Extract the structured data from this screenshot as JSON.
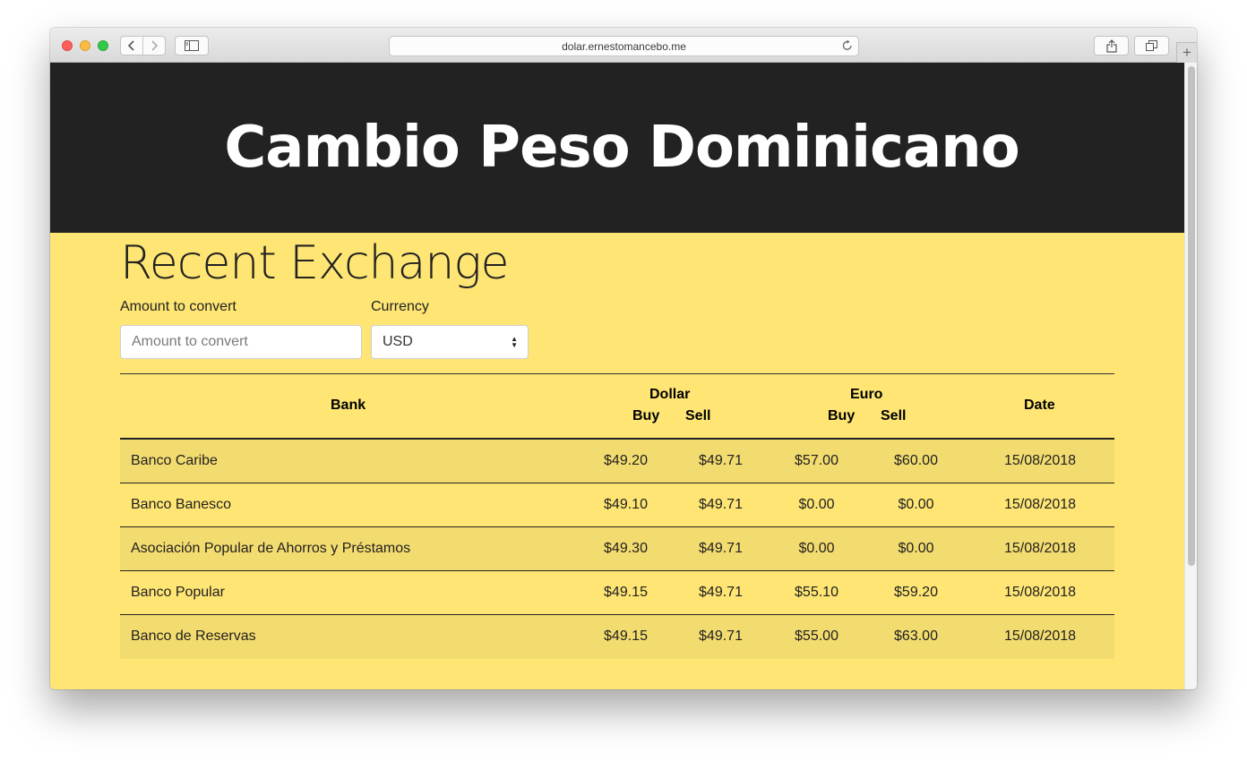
{
  "browser": {
    "url": "dolar.ernestomancebo.me"
  },
  "header": {
    "title": "Cambio Peso Dominicano"
  },
  "main": {
    "section_title": "Recent Exchange",
    "amount": {
      "label": "Amount to convert",
      "placeholder": "Amount to convert",
      "value": ""
    },
    "currency": {
      "label": "Currency",
      "selected": "USD"
    },
    "table": {
      "headers": {
        "bank": "Bank",
        "dollar": "Dollar",
        "euro": "Euro",
        "buy": "Buy",
        "sell": "Sell",
        "date": "Date"
      },
      "rows": [
        {
          "bank": "Banco Caribe",
          "dollar_buy": "$49.20",
          "dollar_sell": "$49.71",
          "euro_buy": "$57.00",
          "euro_sell": "$60.00",
          "date": "15/08/2018"
        },
        {
          "bank": "Banco Banesco",
          "dollar_buy": "$49.10",
          "dollar_sell": "$49.71",
          "euro_buy": "$0.00",
          "euro_sell": "$0.00",
          "date": "15/08/2018"
        },
        {
          "bank": "Asociación Popular de Ahorros y Préstamos",
          "dollar_buy": "$49.30",
          "dollar_sell": "$49.71",
          "euro_buy": "$0.00",
          "euro_sell": "$0.00",
          "date": "15/08/2018"
        },
        {
          "bank": "Banco Popular",
          "dollar_buy": "$49.15",
          "dollar_sell": "$49.71",
          "euro_buy": "$55.10",
          "euro_sell": "$59.20",
          "date": "15/08/2018"
        },
        {
          "bank": "Banco de Reservas",
          "dollar_buy": "$49.15",
          "dollar_sell": "$49.71",
          "euro_buy": "$55.00",
          "euro_sell": "$63.00",
          "date": "15/08/2018"
        }
      ]
    }
  },
  "colors": {
    "hero_bg": "#222222",
    "page_bg": "#fee574",
    "stripe_bg": "#f3dc6f"
  }
}
